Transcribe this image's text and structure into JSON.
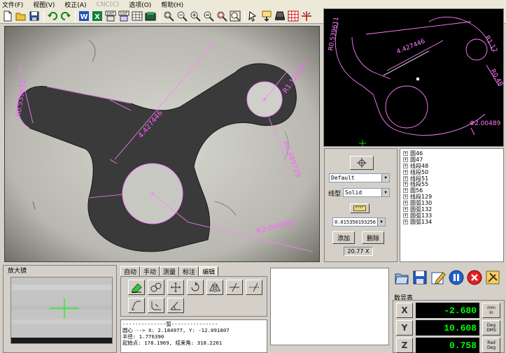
{
  "menu": [
    "文件(F)",
    "视图(V)",
    "校正(A)",
    "CNC(C)",
    "选项(O)",
    "帮助(H)"
  ],
  "toolbar_icons": [
    "new-file-icon",
    "open-folder-icon",
    "save-icon",
    "undo-icon",
    "redo-icon",
    "word-export-icon",
    "excel-export-icon",
    "dxf-export-icon",
    "dxf-import-icon",
    "measure-table-icon",
    "folder-icon",
    "zoom-fit-icon",
    "zoom-out-icon",
    "zoom-in-icon",
    "zoom-minus-icon",
    "zoom-window-icon",
    "zoom-all-icon",
    "pointer-icon",
    "probe-icon",
    "light-icon",
    "grid-icon",
    "crosshair-axis-icon"
  ],
  "main_view": {
    "labels": {
      "radius_left": "R0.539611",
      "radius_top_right": "R1.122347",
      "distance": "4.427446",
      "radius_right": "R0.489729",
      "diameter": "Φ2.004892"
    }
  },
  "preview": {
    "labels": {
      "left": "R0.539611",
      "distance": "4.427446",
      "top_right": "R1.12",
      "right": "R0.48",
      "diameter": "Φ2.00489"
    }
  },
  "settings": {
    "color_select": "Default",
    "linetype_label": "线型",
    "linetype_select": "Solid",
    "tolerance_select": "0.015350193256",
    "add_button": "添加",
    "delete_button": "删除",
    "zoom_readout": "20.77 X"
  },
  "tree": {
    "items": [
      "圆46",
      "圆47",
      "线段48",
      "线段50",
      "线段51",
      "线段55",
      "圆56",
      "线段129",
      "圆弧130",
      "圆弧132",
      "圆弧133",
      "圆弧134"
    ]
  },
  "magnifier": {
    "title": "放大镜"
  },
  "tabs": [
    "自动",
    "手动",
    "测量",
    "标注",
    "编辑"
  ],
  "active_tab": "编辑",
  "output_text": {
    "line1": "--------------弧---------------",
    "line2": "圆心 --> X: 2.184977, Y: -12.091807",
    "line3": "半径: 1.776390",
    "line4": "起始点: 178.1969, 结束角: 318.2261"
  },
  "dro": {
    "title": "数显表",
    "axes": [
      {
        "axis": "X",
        "value": "-2.680",
        "unit": "mm\nin"
      },
      {
        "axis": "Y",
        "value": "10.608",
        "unit": "Deg\nDMS"
      },
      {
        "axis": "Z",
        "value": "0.758",
        "unit": "Rad\nDeg"
      }
    ]
  },
  "action_icons": [
    "open-icon",
    "save-icon",
    "edit-icon",
    "pause-icon",
    "stop-icon",
    "tools-icon"
  ],
  "colors": {
    "measure_line": "#ff80ff",
    "dro_text": "#00ff00",
    "crosshair": "#00ff00"
  }
}
